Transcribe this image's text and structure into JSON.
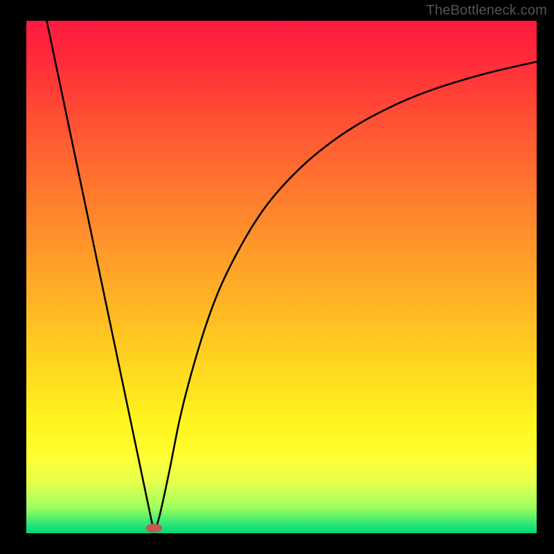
{
  "attribution": "TheBottleneck.com",
  "chart_data": {
    "type": "line",
    "title": "",
    "xlabel": "",
    "ylabel": "",
    "xlim": [
      0,
      100
    ],
    "ylim": [
      0,
      100
    ],
    "background_gradient_stops": [
      {
        "offset": 0.0,
        "color": "#ff1a3f"
      },
      {
        "offset": 0.08,
        "color": "#ff2c3a"
      },
      {
        "offset": 0.2,
        "color": "#ff5233"
      },
      {
        "offset": 0.35,
        "color": "#ff7e2e"
      },
      {
        "offset": 0.5,
        "color": "#ffa728"
      },
      {
        "offset": 0.65,
        "color": "#ffd020"
      },
      {
        "offset": 0.78,
        "color": "#fff41e"
      },
      {
        "offset": 0.85,
        "color": "#ffff33"
      },
      {
        "offset": 0.9,
        "color": "#e6ff4d"
      },
      {
        "offset": 0.95,
        "color": "#9dff5e"
      },
      {
        "offset": 0.98,
        "color": "#33e876"
      },
      {
        "offset": 1.0,
        "color": "#00d87a"
      }
    ],
    "series": [
      {
        "name": "curve",
        "color": "#000000",
        "x": [
          4,
          6,
          8,
          10,
          12,
          14,
          16,
          18,
          20,
          22,
          24,
          25,
          26,
          28,
          30,
          32,
          35,
          38,
          42,
          46,
          50,
          55,
          60,
          65,
          70,
          75,
          80,
          85,
          90,
          95,
          100
        ],
        "y": [
          100,
          90.5,
          81,
          71.5,
          62,
          52.5,
          43,
          33.5,
          24,
          14.5,
          5,
          1,
          3,
          12,
          22,
          30,
          40,
          48,
          56,
          62.5,
          67.5,
          72.5,
          76.5,
          79.8,
          82.5,
          84.8,
          86.7,
          88.3,
          89.7,
          90.9,
          92
        ]
      }
    ],
    "marker": {
      "name": "min-point",
      "color": "#c05a52",
      "cx": 25,
      "cy": 1,
      "rx": 1.6,
      "ry": 0.9
    }
  }
}
